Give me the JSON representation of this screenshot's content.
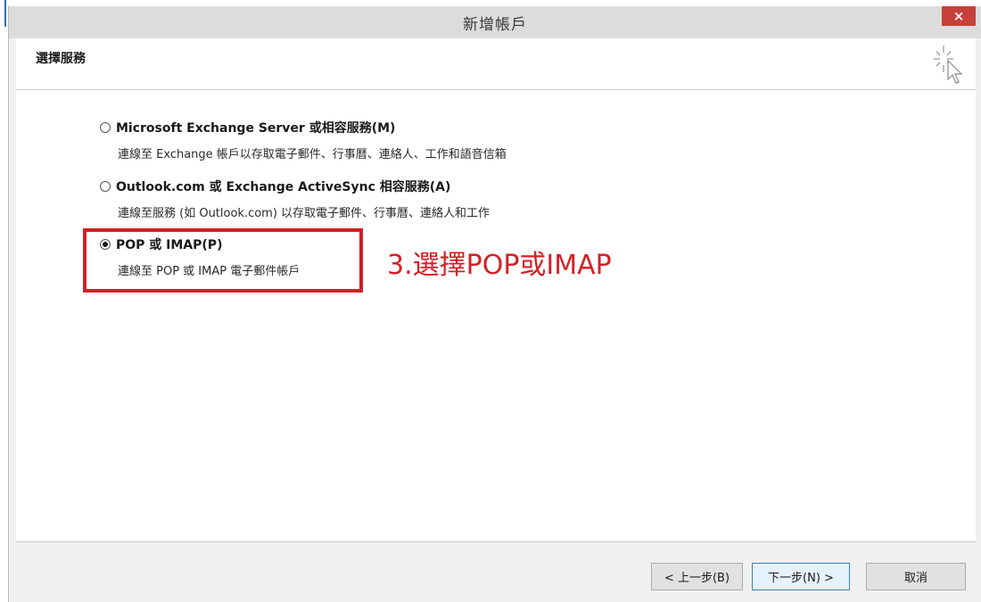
{
  "window": {
    "title": "新增帳戶",
    "close_label": "×"
  },
  "header": {
    "title": "選擇服務",
    "icon": "wizard-sparkle-cursor-icon"
  },
  "options": [
    {
      "label": "Microsoft Exchange Server 或相容服務(M)",
      "description": "連線至 Exchange 帳戶以存取電子郵件、行事曆、連絡人、工作和語音信箱",
      "selected": false
    },
    {
      "label": "Outlook.com 或 Exchange ActiveSync 相容服務(A)",
      "description": "連線至服務 (如 Outlook.com) 以存取電子郵件、行事曆、連絡人和工作",
      "selected": false
    },
    {
      "label": "POP 或 IMAP(P)",
      "description": "連線至 POP 或 IMAP 電子郵件帳戶",
      "selected": true
    }
  ],
  "annotation": {
    "text": "3.選擇POP或IMAP",
    "color": "#d32027"
  },
  "buttons": {
    "back": "< 上一步(B)",
    "next": "下一步(N) >",
    "cancel": "取消"
  },
  "colors": {
    "close_button": "#c7413a",
    "highlight": "#d32027"
  }
}
